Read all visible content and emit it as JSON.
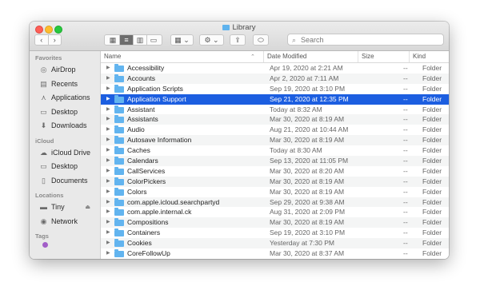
{
  "window": {
    "title": "Library"
  },
  "toolbar": {
    "back_icon": "chevron-left-icon",
    "forward_icon": "chevron-right-icon",
    "view_modes": [
      "icon-view",
      "list-view",
      "column-view",
      "gallery-view"
    ],
    "active_view": "list-view",
    "search_placeholder": "Search"
  },
  "sidebar": {
    "sections": [
      {
        "heading": "Favorites",
        "items": [
          {
            "label": "AirDrop",
            "icon": "airdrop-icon"
          },
          {
            "label": "Recents",
            "icon": "recents-icon"
          },
          {
            "label": "Applications",
            "icon": "applications-icon"
          },
          {
            "label": "Desktop",
            "icon": "desktop-icon"
          },
          {
            "label": "Downloads",
            "icon": "downloads-icon"
          }
        ]
      },
      {
        "heading": "iCloud",
        "items": [
          {
            "label": "iCloud Drive",
            "icon": "cloud-icon"
          },
          {
            "label": "Desktop",
            "icon": "desktop-icon"
          },
          {
            "label": "Documents",
            "icon": "documents-icon"
          }
        ]
      },
      {
        "heading": "Locations",
        "items": [
          {
            "label": "Tiny",
            "icon": "drive-icon"
          },
          {
            "label": "Network",
            "icon": "network-icon"
          }
        ]
      },
      {
        "heading": "Tags",
        "items": []
      }
    ]
  },
  "columns": {
    "name": "Name",
    "date": "Date Modified",
    "size": "Size",
    "kind": "Kind"
  },
  "rows": [
    {
      "name": "Accessibility",
      "date": "Apr 19, 2020 at 2:21 AM",
      "size": "--",
      "kind": "Folder"
    },
    {
      "name": "Accounts",
      "date": "Apr 2, 2020 at 7:11 AM",
      "size": "--",
      "kind": "Folder"
    },
    {
      "name": "Application Scripts",
      "date": "Sep 19, 2020 at 3:10 PM",
      "size": "--",
      "kind": "Folder"
    },
    {
      "name": "Application Support",
      "date": "Sep 21, 2020 at 12:35 PM",
      "size": "--",
      "kind": "Folder",
      "selected": true
    },
    {
      "name": "Assistant",
      "date": "Today at 8:32 AM",
      "size": "--",
      "kind": "Folder"
    },
    {
      "name": "Assistants",
      "date": "Mar 30, 2020 at 8:19 AM",
      "size": "--",
      "kind": "Folder"
    },
    {
      "name": "Audio",
      "date": "Aug 21, 2020 at 10:44 AM",
      "size": "--",
      "kind": "Folder"
    },
    {
      "name": "Autosave Information",
      "date": "Mar 30, 2020 at 8:19 AM",
      "size": "--",
      "kind": "Folder"
    },
    {
      "name": "Caches",
      "date": "Today at 8:30 AM",
      "size": "--",
      "kind": "Folder"
    },
    {
      "name": "Calendars",
      "date": "Sep 13, 2020 at 11:05 PM",
      "size": "--",
      "kind": "Folder"
    },
    {
      "name": "CallServices",
      "date": "Mar 30, 2020 at 8:20 AM",
      "size": "--",
      "kind": "Folder"
    },
    {
      "name": "ColorPickers",
      "date": "Mar 30, 2020 at 8:19 AM",
      "size": "--",
      "kind": "Folder"
    },
    {
      "name": "Colors",
      "date": "Mar 30, 2020 at 8:19 AM",
      "size": "--",
      "kind": "Folder"
    },
    {
      "name": "com.apple.icloud.searchpartyd",
      "date": "Sep 29, 2020 at 9:38 AM",
      "size": "--",
      "kind": "Folder"
    },
    {
      "name": "com.apple.internal.ck",
      "date": "Aug 31, 2020 at 2:09 PM",
      "size": "--",
      "kind": "Folder"
    },
    {
      "name": "Compositions",
      "date": "Mar 30, 2020 at 8:19 AM",
      "size": "--",
      "kind": "Folder"
    },
    {
      "name": "Containers",
      "date": "Sep 19, 2020 at 3:10 PM",
      "size": "--",
      "kind": "Folder"
    },
    {
      "name": "Cookies",
      "date": "Yesterday at 7:30 PM",
      "size": "--",
      "kind": "Folder"
    },
    {
      "name": "CoreFollowUp",
      "date": "Mar 30, 2020 at 8:37 AM",
      "size": "--",
      "kind": "Folder"
    }
  ],
  "colors": {
    "selection": "#1c5ee0",
    "folder": "#62b4ef"
  }
}
